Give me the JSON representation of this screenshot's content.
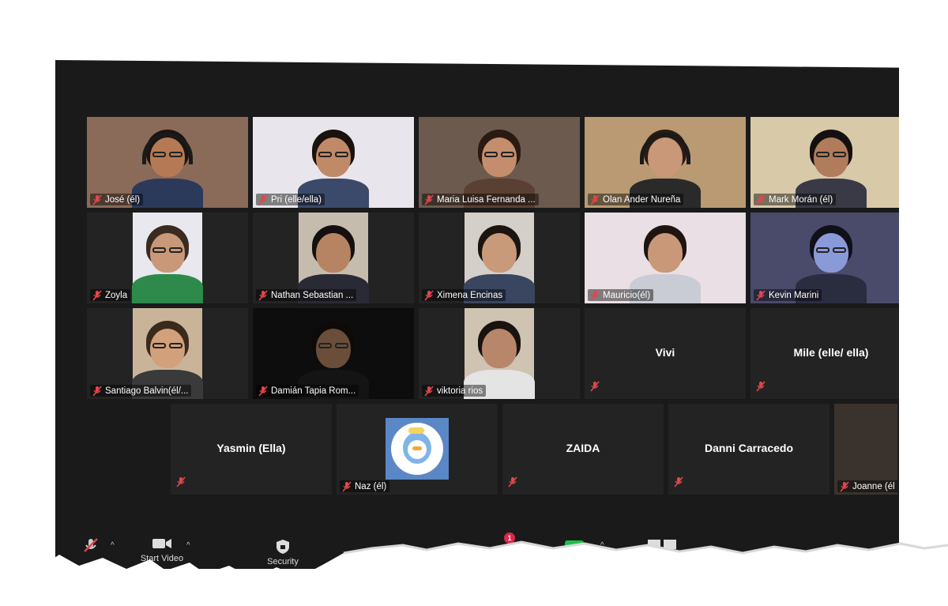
{
  "participants_row1": [
    {
      "name": "José (él)",
      "video": true,
      "skin": "#b57a55",
      "hair": "#1b1410",
      "shirt": "#2b3a5a",
      "bg": "#8a6a58",
      "glasses": true,
      "headphones": true
    },
    {
      "name": "Pri (elle/ella)",
      "video": true,
      "skin": "#c08a68",
      "hair": "#1a120e",
      "shirt": "#3b4a6a",
      "bg": "#e8e6ec",
      "glasses": true
    },
    {
      "name": "Maria Luisa Fernanda ...",
      "video": true,
      "active": true,
      "skin": "#c48e6e",
      "hair": "#2a1a12",
      "shirt": "#5a4032",
      "bg": "#6d5a4e",
      "glasses": true
    },
    {
      "name": "Olan Ander Nureña",
      "video": true,
      "skin": "#c89878",
      "hair": "#2a1a12",
      "shirt": "#2a2a2a",
      "bg": "#b99a72",
      "headphones": true
    },
    {
      "name": "Mark Morán (él)",
      "video": true,
      "skin": "#b07c5c",
      "hair": "#141010",
      "shirt": "#3a3a46",
      "bg": "#d8c9a8",
      "glasses": true
    }
  ],
  "participants_row2": [
    {
      "name": "Zoyla",
      "video": true,
      "skin": "#c89878",
      "hair": "#3a2a20",
      "shirt": "#2e8a4a",
      "bg": "#e8e8ee",
      "glasses": true,
      "narrow": true
    },
    {
      "name": "Nathan Sebastian ...",
      "video": true,
      "skin": "#b68462",
      "hair": "#141010",
      "shirt": "#2a2a36",
      "bg": "#c6bcae",
      "narrow": true
    },
    {
      "name": "Ximena Encinas",
      "video": true,
      "skin": "#c89a7a",
      "hair": "#1c140e",
      "shirt": "#3a4660",
      "bg": "#d4cfc8",
      "narrow": true
    },
    {
      "name": "Mauricio(él)",
      "video": true,
      "skin": "#c89878",
      "hair": "#1e1410",
      "shirt": "#c9ccd4",
      "bg": "#e9dfe4"
    },
    {
      "name": "Kevin Marini",
      "video": true,
      "skin": "#8a9ad8",
      "hair": "#101018",
      "shirt": "#2a2c40",
      "bg": "#4a4a6a",
      "glasses": true
    }
  ],
  "participants_row3": [
    {
      "name": "Santiago Balvin(él/...",
      "video": true,
      "skin": "#d2a07a",
      "hair": "#3a2a1c",
      "shirt": "#3a3a3a",
      "bg": "#c9b49a",
      "glasses": true,
      "narrow": true
    },
    {
      "name": "Damián Tapia Rom...",
      "video": true,
      "skin": "#6a4e3a",
      "hair": "#0e0a08",
      "shirt": "#141414",
      "bg": "#0d0d0d",
      "glasses": true
    },
    {
      "name": "viktoria rios",
      "video": true,
      "skin": "#b8866a",
      "hair": "#1a120e",
      "shirt": "#e4e4e4",
      "bg": "#cfc3b2",
      "narrow": true
    },
    {
      "name": "Vivi",
      "video": false
    },
    {
      "name": "Mile (elle/ ella)",
      "video": false
    }
  ],
  "participants_row4": [
    {
      "name": "Yasmin (Ella)",
      "video": false
    },
    {
      "name": "Naz (él)",
      "video": false,
      "avatar": true
    },
    {
      "name": "ZAIDA",
      "video": false
    },
    {
      "name": "Danni Carracedo",
      "video": false
    },
    {
      "name": "Joanne (él",
      "video": true,
      "partial": true
    }
  ],
  "toolbar": {
    "video_label": "Start Video",
    "security_label": "Security",
    "chat_badge": "1"
  },
  "colors": {
    "active_speaker": "#c9e05a",
    "mic_muted": "#e0464c",
    "share_green": "#1fbd4a",
    "badge_red": "#e0264c"
  }
}
